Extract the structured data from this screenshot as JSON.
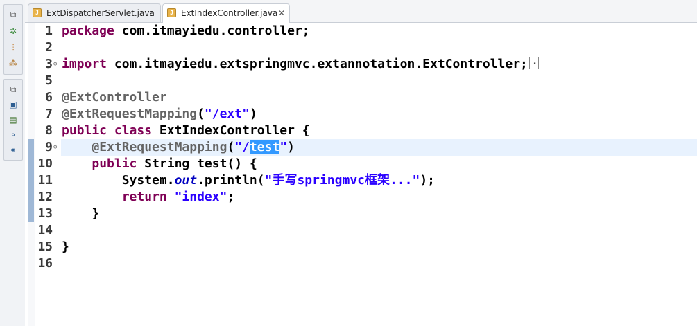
{
  "tabs": [
    {
      "label": "ExtDispatcherServlet.java",
      "active": false
    },
    {
      "label": "ExtIndexController.java",
      "active": true,
      "close": "✕"
    }
  ],
  "editor": {
    "lines": [
      {
        "n": "1",
        "t": [
          [
            "package",
            "kw"
          ],
          [
            " com.itmayiedu.controller;",
            ""
          ]
        ]
      },
      {
        "n": "2",
        "t": []
      },
      {
        "n": "3",
        "fold": "⊕",
        "t": [
          [
            "import",
            "kw"
          ],
          [
            " com.itmayiedu.extspringmvc.extannotation.ExtController;",
            ""
          ]
        ],
        "collapsed": true
      },
      {
        "n": "5",
        "t": []
      },
      {
        "n": "6",
        "t": [
          [
            "@ExtController",
            "ann"
          ]
        ]
      },
      {
        "n": "7",
        "t": [
          [
            "@ExtRequestMapping",
            "ann"
          ],
          [
            "(",
            ""
          ],
          [
            "\"/ext\"",
            "str"
          ],
          [
            ")",
            ""
          ]
        ]
      },
      {
        "n": "8",
        "t": [
          [
            "public",
            "kw"
          ],
          [
            " ",
            ""
          ],
          [
            "class",
            "kw"
          ],
          [
            " ExtIndexController {",
            ""
          ]
        ]
      },
      {
        "n": "9",
        "fold": "⊖",
        "current": true,
        "t": [
          [
            "    ",
            ""
          ],
          [
            "@ExtRequestMapping",
            "ann"
          ],
          [
            "(",
            ""
          ],
          [
            "\"/",
            "str"
          ],
          [
            "test",
            "sel"
          ],
          [
            "\"",
            "str"
          ],
          [
            ")",
            ""
          ]
        ]
      },
      {
        "n": "10",
        "t": [
          [
            "    ",
            ""
          ],
          [
            "public",
            "kw"
          ],
          [
            " String test() {",
            ""
          ]
        ]
      },
      {
        "n": "11",
        "t": [
          [
            "        System.",
            ""
          ],
          [
            "out",
            "fld"
          ],
          [
            ".println(",
            ""
          ],
          [
            "\"手写springmvc框架...\"",
            "str"
          ],
          [
            ");",
            ""
          ]
        ]
      },
      {
        "n": "12",
        "t": [
          [
            "        ",
            ""
          ],
          [
            "return",
            "kw"
          ],
          [
            " ",
            ""
          ],
          [
            "\"index\"",
            "str"
          ],
          [
            ";",
            ""
          ]
        ]
      },
      {
        "n": "13",
        "t": [
          [
            "    }",
            ""
          ]
        ]
      },
      {
        "n": "14",
        "t": []
      },
      {
        "n": "15",
        "t": [
          [
            "}",
            ""
          ]
        ]
      },
      {
        "n": "16",
        "t": []
      }
    ]
  },
  "toolbar_icons": [
    "restore-icon",
    "debug-icon",
    "hierarchy-icon",
    "variables-icon",
    "restore-icon",
    "console-icon",
    "problems-icon",
    "breakpoints-icon",
    "expressions-icon"
  ],
  "colors": {
    "keyword": "#7f0055",
    "annotation": "#646464",
    "string": "#2a00ff",
    "selection": "#3399ff",
    "current_line": "#e8f2fe"
  }
}
